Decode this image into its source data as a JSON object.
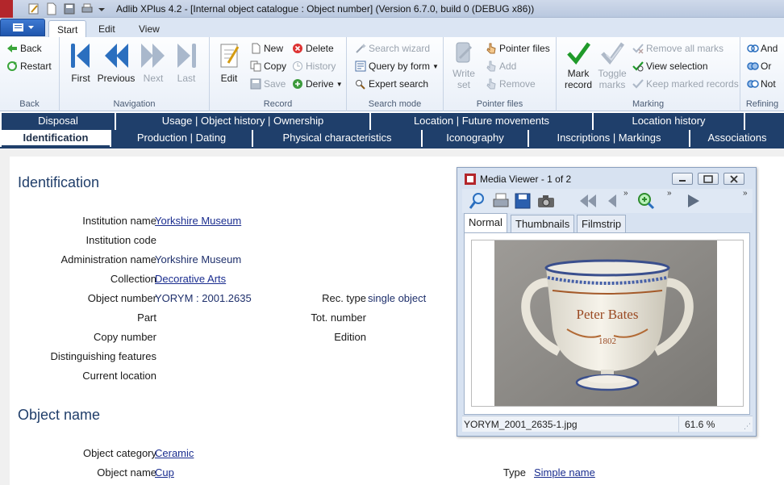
{
  "window": {
    "title": "Adlib XPlus 4.2 - [Internal object catalogue : Object number] (Version 6.7.0, build 0 (DEBUG x86))"
  },
  "ribbon_tabs": [
    "Start",
    "Edit",
    "View"
  ],
  "ribbon": {
    "back": {
      "back": "Back",
      "restart": "Restart",
      "label": "Back"
    },
    "navigation": {
      "first": "First",
      "previous": "Previous",
      "next": "Next",
      "last": "Last",
      "label": "Navigation"
    },
    "record": {
      "edit": "Edit",
      "new": "New",
      "copy": "Copy",
      "save": "Save",
      "delete": "Delete",
      "history": "History",
      "derive": "Derive",
      "label": "Record"
    },
    "search_mode": {
      "search_wizard": "Search wizard",
      "query_by_form": "Query by form",
      "expert_search": "Expert search",
      "label": "Search mode"
    },
    "pointer_files": {
      "write_set_1": "Write",
      "write_set_2": "set",
      "pointer_files": "Pointer files",
      "add": "Add",
      "remove": "Remove",
      "label": "Pointer files"
    },
    "marking": {
      "mark_record_1": "Mark",
      "mark_record_2": "record",
      "toggle_marks_1": "Toggle",
      "toggle_marks_2": "marks",
      "remove_all_marks": "Remove all marks",
      "view_selection": "View selection",
      "keep_marked_records": "Keep marked records",
      "label": "Marking"
    },
    "refining": {
      "and": "And",
      "or": "Or",
      "not": "Not",
      "label": "Refining"
    }
  },
  "screen_tabs_row1": [
    "Disposal",
    "Usage | Object history | Ownership",
    "Location | Future movements",
    "Location history"
  ],
  "screen_tabs_row2": [
    "Identification",
    "Production | Dating",
    "Physical characteristics",
    "Iconography",
    "Inscriptions | Markings",
    "Associations"
  ],
  "identification": {
    "heading": "Identification",
    "institution_name_label": "Institution name",
    "institution_name": "Yorkshire Museum",
    "institution_code_label": "Institution code",
    "administration_name_label": "Administration name",
    "administration_name": "Yorkshire Museum",
    "collection_label": "Collection",
    "collection": "Decorative Arts",
    "object_number_label": "Object number",
    "object_number": "YORYM : 2001.2635",
    "rec_type_label": "Rec. type",
    "rec_type": "single object",
    "part_label": "Part",
    "tot_number_label": "Tot. number",
    "copy_number_label": "Copy number",
    "edition_label": "Edition",
    "distinguishing_features_label": "Distinguishing features",
    "current_location_label": "Current location"
  },
  "object_name": {
    "heading": "Object name",
    "object_category_label": "Object category",
    "object_category": "Ceramic",
    "object_name_label": "Object name",
    "object_name": "Cup",
    "type_label": "Type",
    "type": "Simple name"
  },
  "media_viewer": {
    "title": "Media Viewer - 1 of 2",
    "tabs": [
      "Normal",
      "Thumbnails",
      "Filmstrip"
    ],
    "filename": "YORYM_2001_2635-1.jpg",
    "zoom": "61.6 %",
    "image_text_name": "Peter Bates",
    "image_text_year": "1802"
  }
}
